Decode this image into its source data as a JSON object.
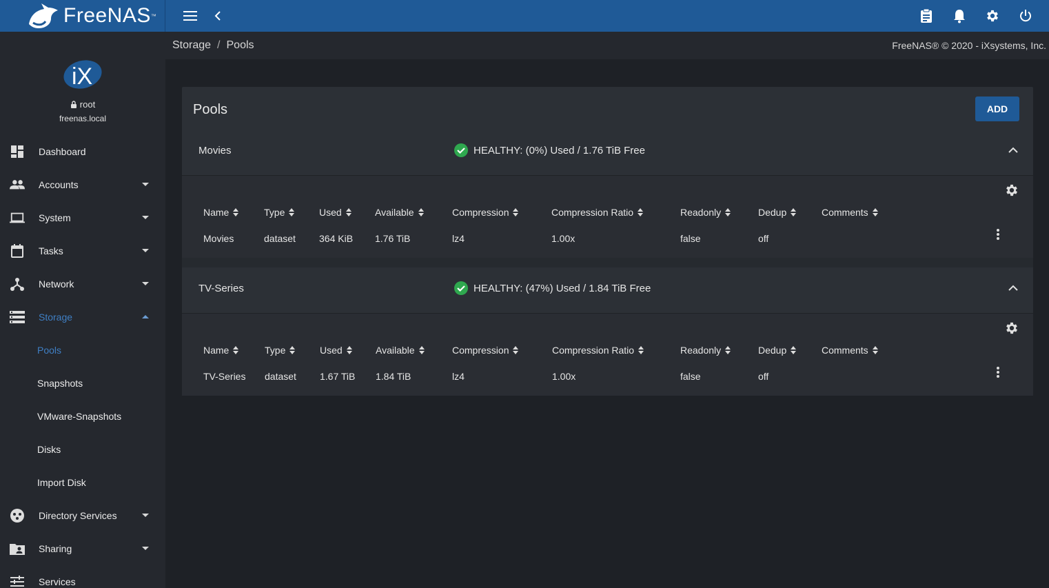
{
  "topbar": {
    "brand": "FreeNAS",
    "brand_tm": "™",
    "accent": "#1f5a97"
  },
  "sidebar": {
    "user": "root",
    "host": "freenas.local",
    "items": [
      {
        "label": "Dashboard",
        "icon": "dashboard-icon"
      },
      {
        "label": "Accounts",
        "icon": "people-icon"
      },
      {
        "label": "System",
        "icon": "laptop-icon"
      },
      {
        "label": "Tasks",
        "icon": "calendar-icon"
      },
      {
        "label": "Network",
        "icon": "network-icon"
      },
      {
        "label": "Storage",
        "icon": "storage-icon"
      },
      {
        "label": "Directory Services",
        "icon": "directory-icon"
      },
      {
        "label": "Sharing",
        "icon": "folder-shared-icon"
      },
      {
        "label": "Services",
        "icon": "tune-icon"
      }
    ],
    "storage_sub": [
      "Pools",
      "Snapshots",
      "VMware-Snapshots",
      "Disks",
      "Import Disk"
    ]
  },
  "breadcrumb": {
    "parent": "Storage",
    "separator": "/",
    "current": "Pools",
    "copyright": "FreeNAS® © 2020 - iXsystems, Inc."
  },
  "card": {
    "title": "Pools",
    "add_label": "ADD"
  },
  "columns": [
    "Name",
    "Type",
    "Used",
    "Available",
    "Compression",
    "Compression Ratio",
    "Readonly",
    "Dedup",
    "Comments"
  ],
  "pools": [
    {
      "name": "Movies",
      "status": "HEALTHY: (0%) Used / 1.76 TiB Free",
      "row": {
        "name": "Movies",
        "type": "dataset",
        "used": "364 KiB",
        "available": "1.76 TiB",
        "compression": "lz4",
        "ratio": "1.00x",
        "readonly": "false",
        "dedup": "off",
        "comments": ""
      }
    },
    {
      "name": "TV-Series",
      "status": "HEALTHY: (47%) Used / 1.84 TiB Free",
      "row": {
        "name": "TV-Series",
        "type": "dataset",
        "used": "1.67 TiB",
        "available": "1.84 TiB",
        "compression": "lz4",
        "ratio": "1.00x",
        "readonly": "false",
        "dedup": "off",
        "comments": ""
      }
    }
  ]
}
